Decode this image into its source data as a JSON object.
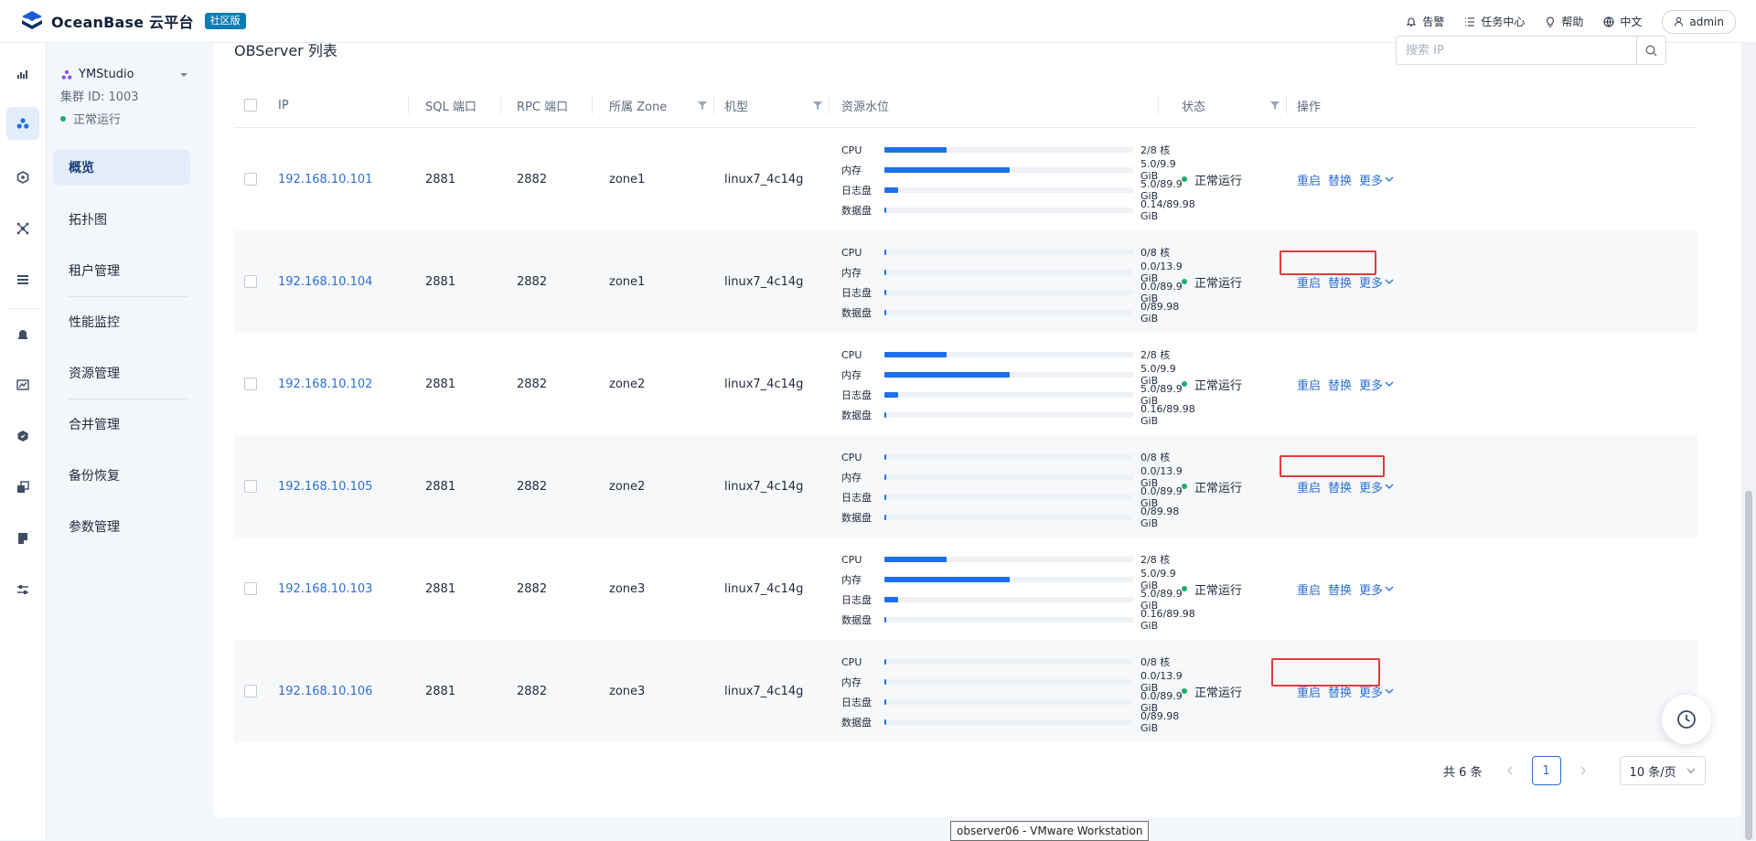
{
  "header": {
    "logo_text": "OceanBase 云平台",
    "edition": "社区版",
    "nav": [
      {
        "label": "告警",
        "icon": "bell-icon"
      },
      {
        "label": "任务中心",
        "icon": "list-icon"
      },
      {
        "label": "帮助",
        "icon": "bulb-icon"
      },
      {
        "label": "中文",
        "icon": "globe-icon"
      }
    ],
    "user": "admin"
  },
  "cluster": {
    "name": "YMStudio",
    "id": "集群 ID: 1003",
    "status": "正常运行"
  },
  "menu": [
    "概览",
    "拓扑图",
    "租户管理",
    "性能监控",
    "资源管理",
    "合并管理",
    "备份恢复",
    "参数管理"
  ],
  "main": {
    "title": "OBServer 列表",
    "search_placeholder": "搜索 IP"
  },
  "table": {
    "columns": [
      "IP",
      "SQL 端口",
      "RPC 端口",
      "所属 Zone",
      "机型",
      "资源水位",
      "状态",
      "操作"
    ],
    "usage_labels": [
      "CPU",
      "内存",
      "日志盘",
      "数据盘"
    ],
    "actions": [
      "重启",
      "替换",
      "更多"
    ],
    "rows": [
      {
        "ip": "192.168.10.101",
        "sql_port": "2881",
        "rpc_port": "2882",
        "zone": "zone1",
        "model": "linux7_4c14g",
        "usage": [
          {
            "value": "2/8 核",
            "fraction": 0.25
          },
          {
            "value": "5.0/9.9 GiB",
            "fraction": 0.505
          },
          {
            "value": "5.0/89.9 GiB",
            "fraction": 0.056
          },
          {
            "value": "0.14/89.98 GiB",
            "fraction": 0.006
          }
        ],
        "status": "正常运行"
      },
      {
        "ip": "192.168.10.104",
        "sql_port": "2881",
        "rpc_port": "2882",
        "zone": "zone1",
        "model": "linux7_4c14g",
        "usage": [
          {
            "value": "0/8 核",
            "fraction": 0
          },
          {
            "value": "0.0/13.9 GiB",
            "fraction": 0
          },
          {
            "value": "0.0/89.9 GiB",
            "fraction": 0
          },
          {
            "value": "0/89.98 GiB",
            "fraction": 0
          }
        ],
        "status": "正常运行"
      },
      {
        "ip": "192.168.10.102",
        "sql_port": "2881",
        "rpc_port": "2882",
        "zone": "zone2",
        "model": "linux7_4c14g",
        "usage": [
          {
            "value": "2/8 核",
            "fraction": 0.25
          },
          {
            "value": "5.0/9.9 GiB",
            "fraction": 0.505
          },
          {
            "value": "5.0/89.9 GiB",
            "fraction": 0.056
          },
          {
            "value": "0.16/89.98 GiB",
            "fraction": 0.006
          }
        ],
        "status": "正常运行"
      },
      {
        "ip": "192.168.10.105",
        "sql_port": "2881",
        "rpc_port": "2882",
        "zone": "zone2",
        "model": "linux7_4c14g",
        "usage": [
          {
            "value": "0/8 核",
            "fraction": 0
          },
          {
            "value": "0.0/13.9 GiB",
            "fraction": 0
          },
          {
            "value": "0.0/89.9 GiB",
            "fraction": 0
          },
          {
            "value": "0/89.98 GiB",
            "fraction": 0
          }
        ],
        "status": "正常运行"
      },
      {
        "ip": "192.168.10.103",
        "sql_port": "2881",
        "rpc_port": "2882",
        "zone": "zone3",
        "model": "linux7_4c14g",
        "usage": [
          {
            "value": "2/8 核",
            "fraction": 0.25
          },
          {
            "value": "5.0/9.9 GiB",
            "fraction": 0.505
          },
          {
            "value": "5.0/89.9 GiB",
            "fraction": 0.056
          },
          {
            "value": "0.16/89.98 GiB",
            "fraction": 0.006
          }
        ],
        "status": "正常运行"
      },
      {
        "ip": "192.168.10.106",
        "sql_port": "2881",
        "rpc_port": "2882",
        "zone": "zone3",
        "model": "linux7_4c14g",
        "usage": [
          {
            "value": "0/8 核",
            "fraction": 0
          },
          {
            "value": "0.0/13.9 GiB",
            "fraction": 0
          },
          {
            "value": "0.0/89.9 GiB",
            "fraction": 0
          },
          {
            "value": "0/89.98 GiB",
            "fraction": 0
          }
        ],
        "status": "正常运行"
      }
    ]
  },
  "pagination": {
    "total": "共 6 条",
    "current": "1",
    "page_size": "10 条/页"
  },
  "tooltip": "observer06 - VMware Workstation",
  "colors": {
    "accent": "#2c6fd6",
    "bar": "#1e6fea",
    "status_ok": "#1aaf67",
    "highlight": "#e33b3b"
  }
}
